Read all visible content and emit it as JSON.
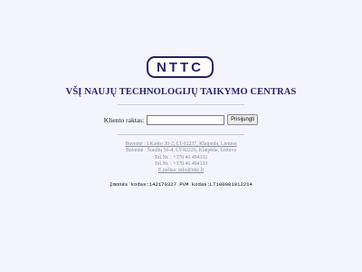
{
  "logo_text": "NTTC",
  "org_title": "VŠĮ NAUJŲ TECHNOLOGIJŲ TAIKYMO CENTRAS",
  "login": {
    "label": "Kliento raktas:",
    "input_value": "",
    "button_label": "Prisijungti"
  },
  "contacts": {
    "line1": "Buveinė : I.Kanto 20-2, LT-92237, Klaipėda, Lietuva",
    "line2": "Buveinė : Šiaulių 56-4, LT-92226, Klaipėda, Lietuva",
    "line3": "Tel.Nr. : +370 46 494332",
    "line4": "Tel.Nr. : +370 46 494133",
    "line5": "E.paštas: info@nttc.lt"
  },
  "codes": "Įmonės kodas:142170327 PVM kodas:LT100001012214"
}
